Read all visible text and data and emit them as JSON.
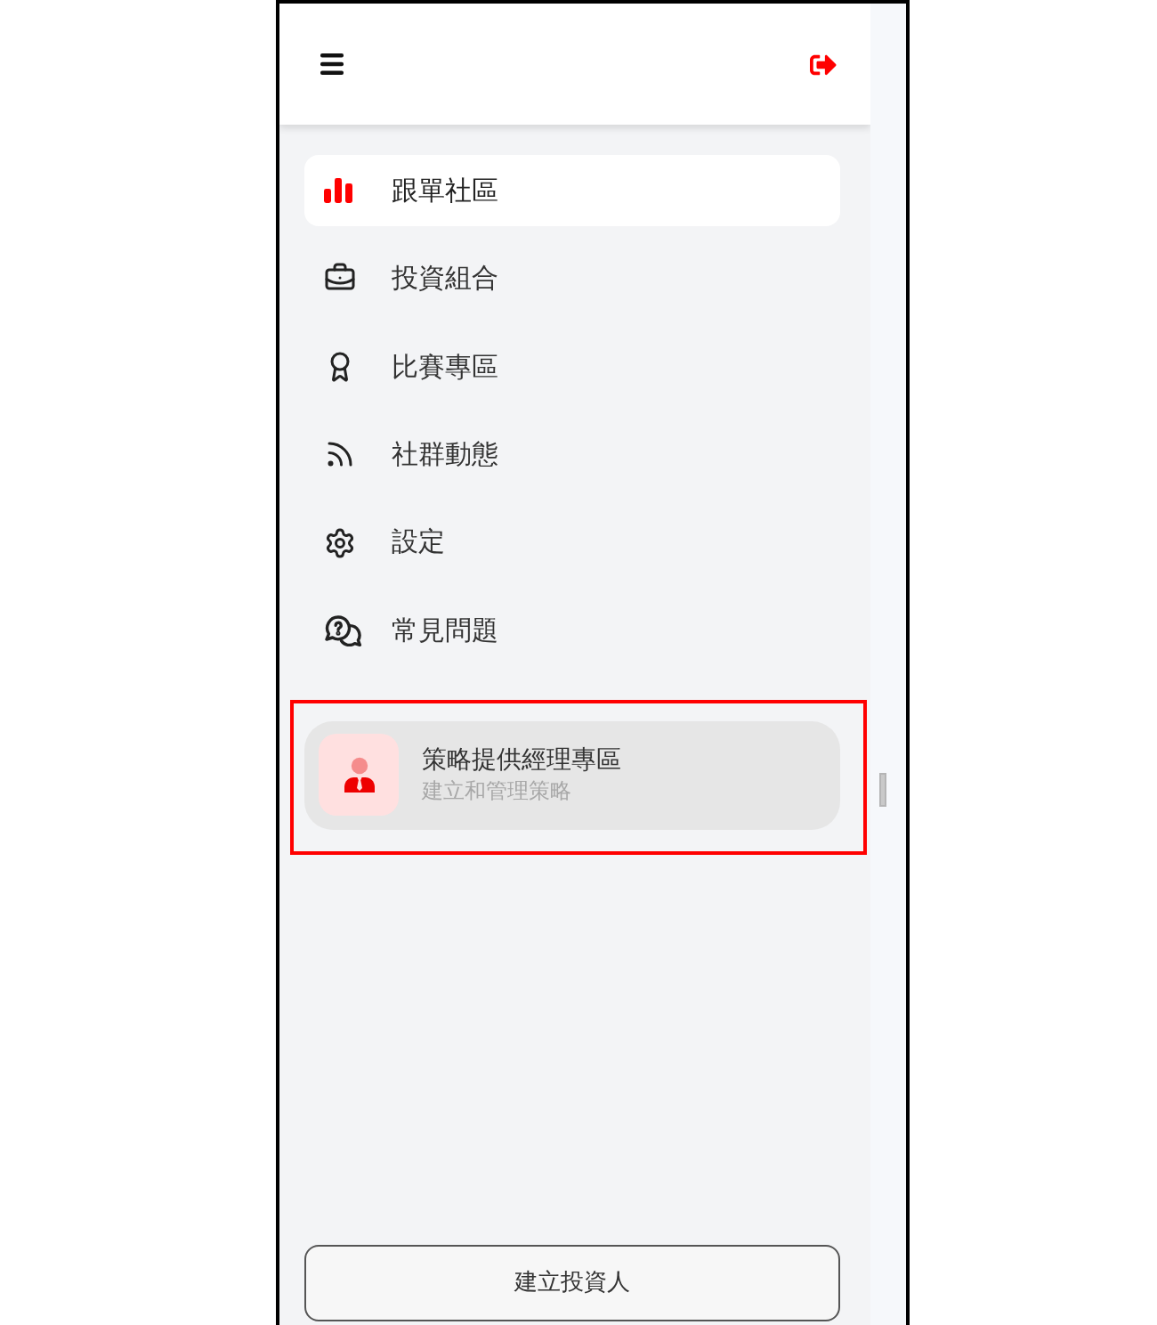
{
  "nav": {
    "items": [
      {
        "label": "跟單社區",
        "selected": true
      },
      {
        "label": "投資組合",
        "selected": false
      },
      {
        "label": "比賽專區",
        "selected": false
      },
      {
        "label": "社群動態",
        "selected": false
      },
      {
        "label": "設定",
        "selected": false
      },
      {
        "label": "常見問題",
        "selected": false
      }
    ]
  },
  "strategy_card": {
    "title": "策略提供經理專區",
    "subtitle": "建立和管理策略",
    "highlighted": true
  },
  "create_button": {
    "label": "建立投資人"
  }
}
